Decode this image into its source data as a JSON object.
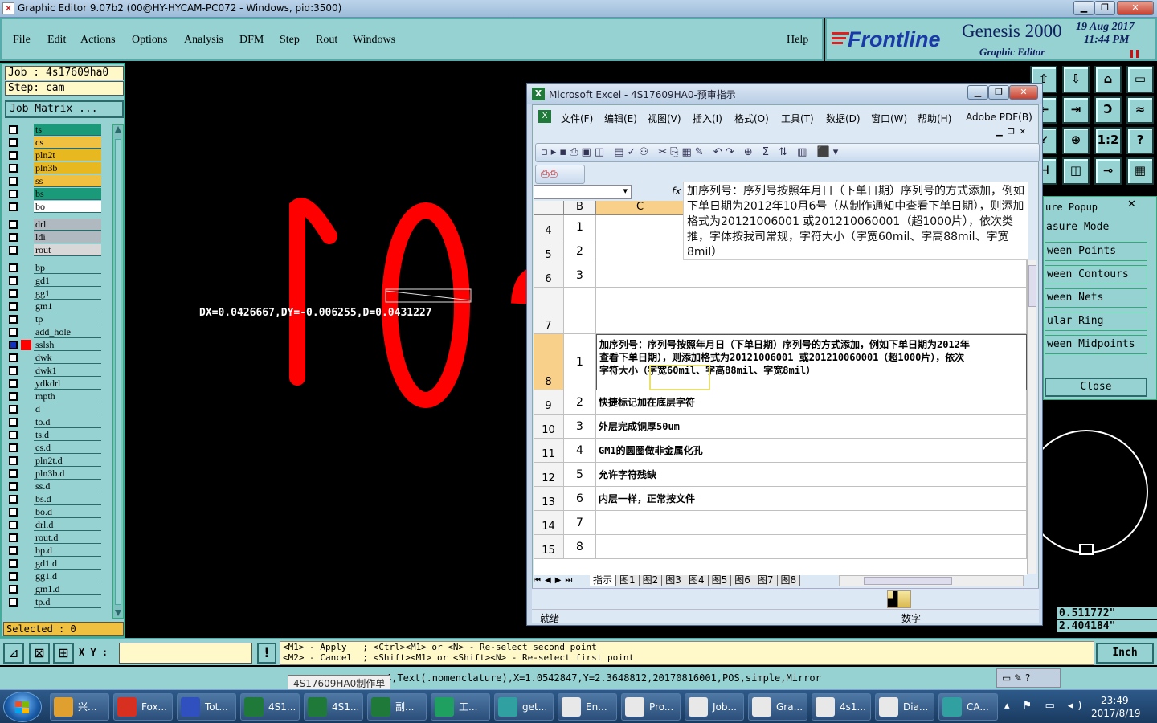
{
  "window": {
    "title": "Graphic Editor 9.07b2 (00@HY-HYCAM-PC072 - Windows, pid:3500)"
  },
  "menu": {
    "items": [
      {
        "label": "File"
      },
      {
        "label": "Edit"
      },
      {
        "label": "Actions"
      },
      {
        "label": "Options"
      },
      {
        "label": "Analysis"
      },
      {
        "label": "DFM"
      },
      {
        "label": "Step"
      },
      {
        "label": "Rout"
      },
      {
        "label": "Windows"
      }
    ],
    "help": "Help"
  },
  "brand": {
    "logo": "Frontline",
    "product": "Genesis 2000",
    "subtitle": "Graphic Editor",
    "date": "19 Aug 2017",
    "time": "11:44 PM"
  },
  "job": {
    "job_label": "Job : 4s17609ha0",
    "step_label": "Step: cam",
    "matrix_button": "Job Matrix ..."
  },
  "layers": [
    {
      "name": "ts",
      "color": "#1a9a78"
    },
    {
      "name": "cs",
      "color": "#f0c040"
    },
    {
      "name": "pln2t",
      "color": "#e8b820"
    },
    {
      "name": "pln3b",
      "color": "#e8b820"
    },
    {
      "name": "ss",
      "color": "#f0c040"
    },
    {
      "name": "bs",
      "color": "#1a9a78"
    },
    {
      "name": "bo",
      "color": "#ffffff"
    },
    {
      "name": "drl",
      "color": "#b0b8c0"
    },
    {
      "name": "ldi",
      "color": "#b0b8c0"
    },
    {
      "name": "rout",
      "color": "#d8d8d8"
    },
    {
      "name": "bp",
      "color": "#96d2d2"
    },
    {
      "name": "gd1",
      "color": "#96d2d2"
    },
    {
      "name": "gg1",
      "color": "#96d2d2"
    },
    {
      "name": "gm1",
      "color": "#96d2d2"
    },
    {
      "name": "tp",
      "color": "#96d2d2"
    },
    {
      "name": "add_hole",
      "color": "#96d2d2"
    },
    {
      "name": "sslsh",
      "color": "#96d2d2"
    },
    {
      "name": "dwk",
      "color": "#96d2d2"
    },
    {
      "name": "dwk1",
      "color": "#96d2d2"
    },
    {
      "name": "ydkdrl",
      "color": "#96d2d2"
    },
    {
      "name": "mpth",
      "color": "#96d2d2"
    },
    {
      "name": "d",
      "color": "#96d2d2"
    },
    {
      "name": "to.d",
      "color": "#96d2d2"
    },
    {
      "name": "ts.d",
      "color": "#96d2d2"
    },
    {
      "name": "cs.d",
      "color": "#96d2d2"
    },
    {
      "name": "pln2t.d",
      "color": "#96d2d2"
    },
    {
      "name": "pln3b.d",
      "color": "#96d2d2"
    },
    {
      "name": "ss.d",
      "color": "#96d2d2"
    },
    {
      "name": "bs.d",
      "color": "#96d2d2"
    },
    {
      "name": "bo.d",
      "color": "#96d2d2"
    },
    {
      "name": "drl.d",
      "color": "#96d2d2"
    },
    {
      "name": "rout.d",
      "color": "#96d2d2"
    },
    {
      "name": "bp.d",
      "color": "#96d2d2"
    },
    {
      "name": "gd1.d",
      "color": "#96d2d2"
    },
    {
      "name": "gg1.d",
      "color": "#96d2d2"
    },
    {
      "name": "gm1.d",
      "color": "#96d2d2"
    },
    {
      "name": "tp.d",
      "color": "#96d2d2"
    }
  ],
  "selected": "Selected : 0",
  "measure": {
    "readout": "DX=0.0426667,DY=-0.006255,D=0.0431227"
  },
  "excel": {
    "title": "Microsoft Excel - 4S17609HA0-预审指示",
    "menus": [
      "文件(F)",
      "编辑(E)",
      "视图(V)",
      "插入(I)",
      "格式(O)",
      "工具(T)",
      "数据(D)",
      "窗口(W)",
      "帮助(H)",
      "Adobe PDF(B)"
    ],
    "formula_text": "加序列号：序列号按照年月日（下单日期）序列号的方式添加，例如下单日期为2012年10月6号（从制作通知中查看下单日期），则添加格式为20121006001 或201210060001（超1000片），依次类推，字体按我司常规，字符大小（字宽60mil、字高88mil、字宽8mil）",
    "col_b": "B",
    "col_c": "C",
    "rows": [
      {
        "num": "4",
        "b": "1",
        "c": ""
      },
      {
        "num": "5",
        "b": "2",
        "c": ""
      },
      {
        "num": "6",
        "b": "3",
        "c": ""
      },
      {
        "num": "7",
        "b": "",
        "c": ""
      },
      {
        "num": "8",
        "b": "1",
        "c": "加序列号：序列号按照年月日（下单日期）序列号的方式添加，例如下单日期为2012年",
        "c2": "查看下单日期），则添加格式为20121006001 或201210060001（超1000片），依次",
        "c3": "字符大小（字宽60mil、字高88mil、字宽8mil）"
      },
      {
        "num": "9",
        "b": "2",
        "c": "快捷标记加在底层字符"
      },
      {
        "num": "10",
        "b": "3",
        "c": "外层完成铜厚50um"
      },
      {
        "num": "11",
        "b": "4",
        "c": "GM1的圆圈做非金属化孔"
      },
      {
        "num": "12",
        "b": "5",
        "c": "允许字符残缺"
      },
      {
        "num": "13",
        "b": "6",
        "c": "内层一样，正常按文件"
      },
      {
        "num": "14",
        "b": "7",
        "c": ""
      },
      {
        "num": "15",
        "b": "8",
        "c": ""
      }
    ],
    "sheets": [
      "指示",
      "图1",
      "图2",
      "图3",
      "图4",
      "图5",
      "图6",
      "图7",
      "图8"
    ],
    "status_left": "就绪",
    "status_right": "数字"
  },
  "measure_popup": {
    "title": "ure Popup",
    "items": [
      "asure Mode",
      "ween Points",
      "ween Contours",
      "ween Nets",
      "ular Ring",
      "ween Midpoints"
    ],
    "close": "Close",
    "coord1": "0.511772\"",
    "coord2": "2.404184\""
  },
  "statusbar": {
    "xy_label": "X Y :",
    "hint1": "<M1> - Apply   ; <Ctrl><M1> or <N> - Re-select second point",
    "hint2": "<M2> - Cancel  ; <Shift><M1> or <Shift><N> - Re-select first point",
    "units": "Inch"
  },
  "cmdline": "4,Text(.nomenclature),X=1.0542847,Y=2.3648812,20170816001,POS,simple,Mirror",
  "tooltip": "4S17609HA0制作单",
  "taskbar": {
    "tasks": [
      {
        "label": "兴...",
        "color": "#e0a030"
      },
      {
        "label": "Fox...",
        "color": "#d83020"
      },
      {
        "label": "Tot...",
        "color": "#3050c0"
      },
      {
        "label": "4S1...",
        "color": "#1f7a3a"
      },
      {
        "label": "4S1...",
        "color": "#1f7a3a"
      },
      {
        "label": "副...",
        "color": "#1f7a3a"
      },
      {
        "label": "工...",
        "color": "#20a060"
      },
      {
        "label": "get...",
        "color": "#30a0a0"
      },
      {
        "label": "En...",
        "color": "#e8e8e8"
      },
      {
        "label": "Pro...",
        "color": "#e8e8e8"
      },
      {
        "label": "Job...",
        "color": "#e8e8e8"
      },
      {
        "label": "Gra...",
        "color": "#e8e8e8"
      },
      {
        "label": "4s1...",
        "color": "#e8e8e8"
      },
      {
        "label": "Dia...",
        "color": "#e8e8e8"
      },
      {
        "label": "CA...",
        "color": "#30a0a0"
      }
    ],
    "clock_time": "23:49",
    "clock_date": "2017/8/19"
  }
}
